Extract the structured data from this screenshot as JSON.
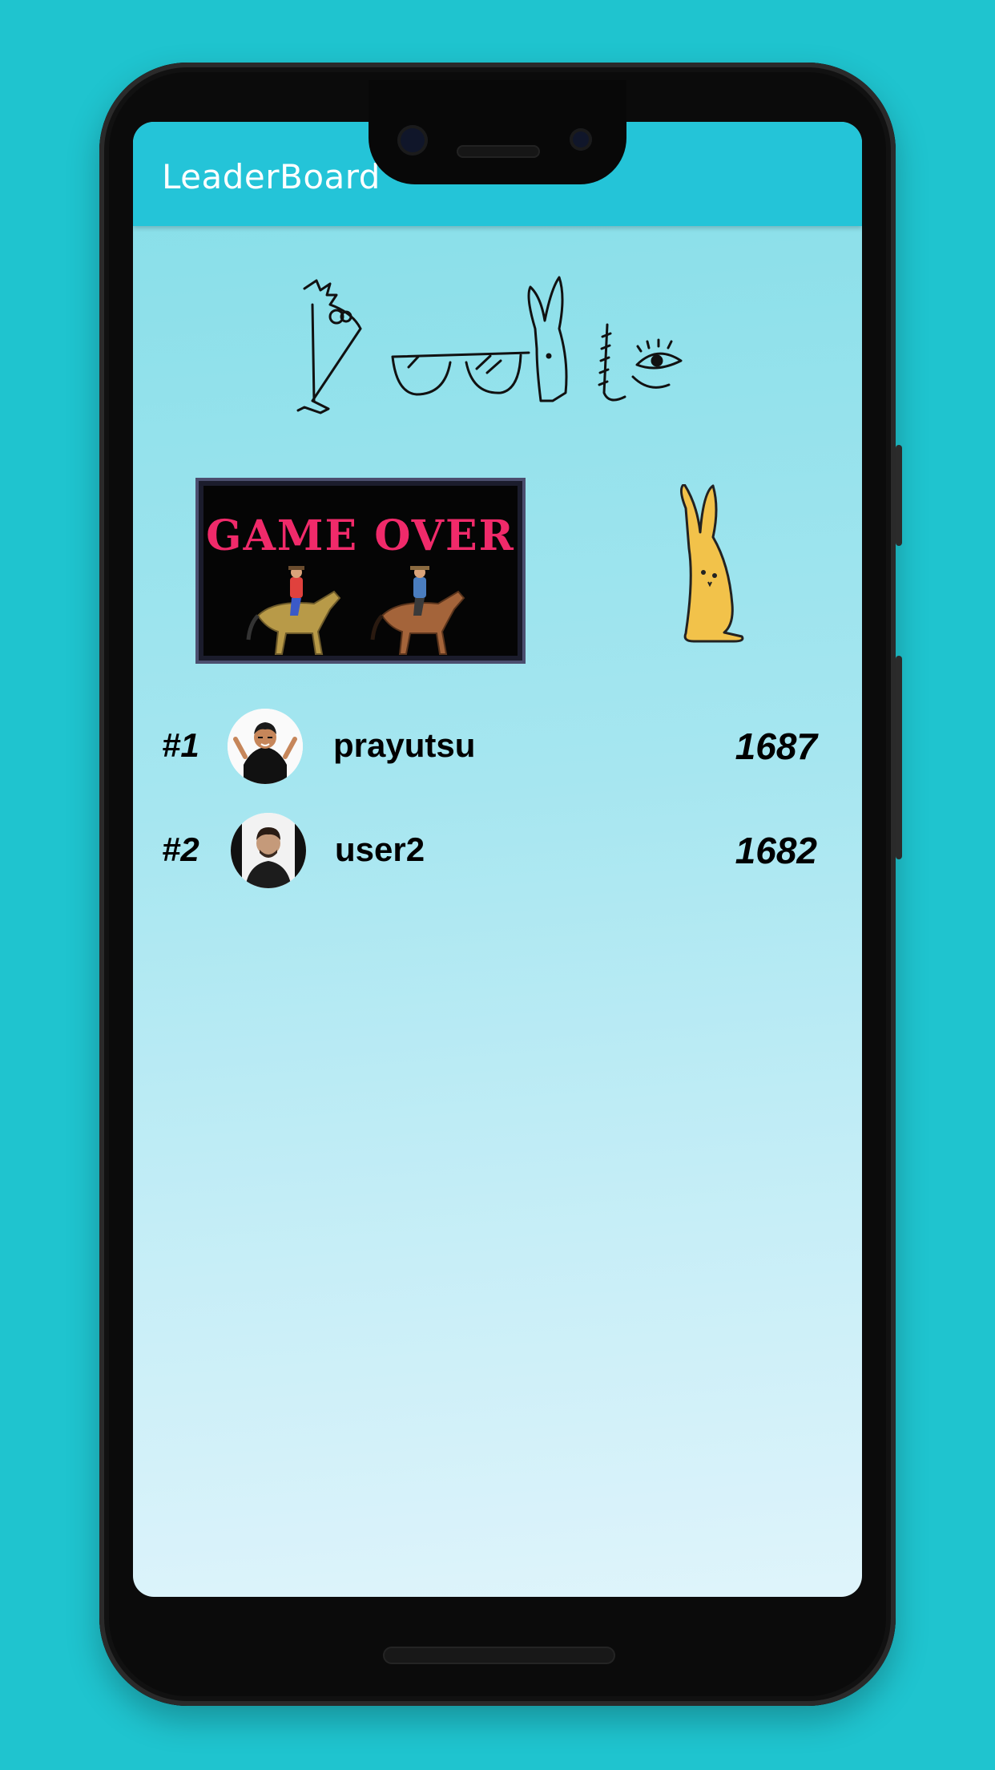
{
  "appbar": {
    "title": "LeaderBoard"
  },
  "banner": {
    "text": "GAME OVER"
  },
  "leaderboard": [
    {
      "rank": "#1",
      "username": "prayutsu",
      "score": "1687"
    },
    {
      "rank": "#2",
      "username": "user2",
      "score": "1682"
    }
  ],
  "colors": {
    "background": "#1fc4cf",
    "appbar": "#24c4d8",
    "banner_text": "#f02a6a",
    "rabbit": "#f2c24a"
  },
  "icons": {
    "logo": "doodle-logo-icon",
    "rabbit": "rabbit-icon",
    "avatar_1": "avatar-cartoon-icon",
    "avatar_2": "avatar-photo-icon"
  }
}
